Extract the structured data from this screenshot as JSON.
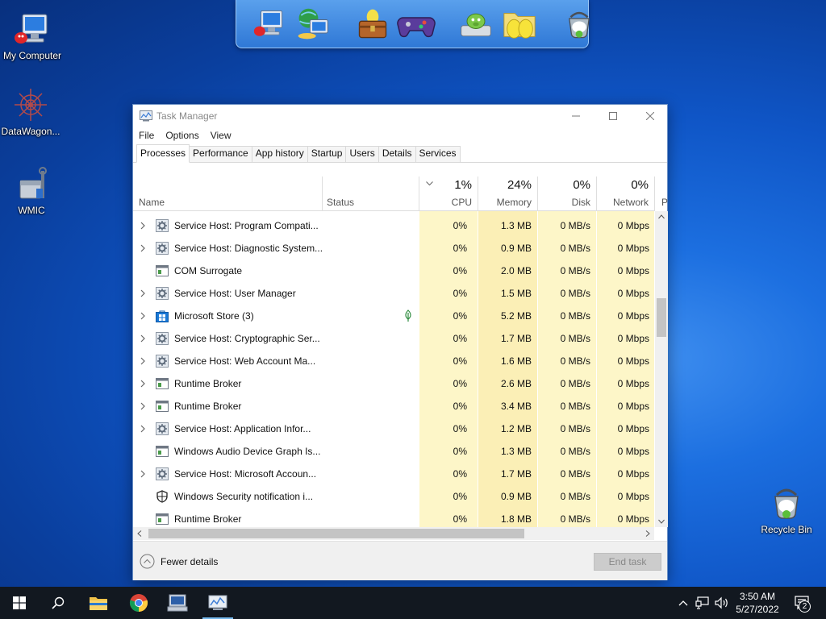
{
  "desktop": {
    "icons": [
      {
        "label": "My Computer",
        "icon": "my-computer-icon"
      },
      {
        "label": "DataWagon...",
        "icon": "datawagon-icon"
      },
      {
        "label": "WMIC",
        "icon": "wmic-icon"
      },
      {
        "label": "Recycle Bin",
        "icon": "recycle-bin-icon"
      }
    ]
  },
  "dock": {
    "items": [
      "my-computer-icon",
      "network-globe-icon",
      "treasure-chest-icon",
      "gamepad-icon",
      "green-pig-drive-icon",
      "eggs-folder-icon",
      "recycle-bin-icon"
    ]
  },
  "window": {
    "title": "Task Manager",
    "menu": [
      "File",
      "Options",
      "View"
    ],
    "tabs": [
      "Processes",
      "Performance",
      "App history",
      "Startup",
      "Users",
      "Details",
      "Services"
    ],
    "active_tab": "Processes",
    "columns": {
      "name": "Name",
      "status": "Status",
      "cpu": {
        "pct": "1%",
        "label": "CPU"
      },
      "memory": {
        "pct": "24%",
        "label": "Memory"
      },
      "disk": {
        "pct": "0%",
        "label": "Disk"
      },
      "network": {
        "pct": "0%",
        "label": "Network"
      },
      "power": {
        "label": "P"
      }
    },
    "processes": [
      {
        "name": "Service Host: Program Compati...",
        "expandable": true,
        "icon": "service-gear-icon",
        "status": "",
        "cpu": "0%",
        "memory": "1.3 MB",
        "disk": "0 MB/s",
        "network": "0 Mbps"
      },
      {
        "name": "Service Host: Diagnostic System...",
        "expandable": true,
        "icon": "service-gear-icon",
        "status": "",
        "cpu": "0%",
        "memory": "0.9 MB",
        "disk": "0 MB/s",
        "network": "0 Mbps"
      },
      {
        "name": "COM Surrogate",
        "expandable": false,
        "icon": "app-window-icon",
        "status": "",
        "cpu": "0%",
        "memory": "2.0 MB",
        "disk": "0 MB/s",
        "network": "0 Mbps"
      },
      {
        "name": "Service Host: User Manager",
        "expandable": true,
        "icon": "service-gear-icon",
        "status": "",
        "cpu": "0%",
        "memory": "1.5 MB",
        "disk": "0 MB/s",
        "network": "0 Mbps"
      },
      {
        "name": "Microsoft Store (3)",
        "expandable": true,
        "icon": "store-icon",
        "status": "suspended-leaf-icon",
        "cpu": "0%",
        "memory": "5.2 MB",
        "disk": "0 MB/s",
        "network": "0 Mbps"
      },
      {
        "name": "Service Host: Cryptographic Ser...",
        "expandable": true,
        "icon": "service-gear-icon",
        "status": "",
        "cpu": "0%",
        "memory": "1.7 MB",
        "disk": "0 MB/s",
        "network": "0 Mbps"
      },
      {
        "name": "Service Host: Web Account Ma...",
        "expandable": true,
        "icon": "service-gear-icon",
        "status": "",
        "cpu": "0%",
        "memory": "1.6 MB",
        "disk": "0 MB/s",
        "network": "0 Mbps"
      },
      {
        "name": "Runtime Broker",
        "expandable": true,
        "icon": "app-window-icon",
        "status": "",
        "cpu": "0%",
        "memory": "2.6 MB",
        "disk": "0 MB/s",
        "network": "0 Mbps"
      },
      {
        "name": "Runtime Broker",
        "expandable": true,
        "icon": "app-window-icon",
        "status": "",
        "cpu": "0%",
        "memory": "3.4 MB",
        "disk": "0 MB/s",
        "network": "0 Mbps"
      },
      {
        "name": "Service Host: Application Infor...",
        "expandable": true,
        "icon": "service-gear-icon",
        "status": "",
        "cpu": "0%",
        "memory": "1.2 MB",
        "disk": "0 MB/s",
        "network": "0 Mbps"
      },
      {
        "name": "Windows Audio Device Graph Is...",
        "expandable": false,
        "icon": "app-window-icon",
        "status": "",
        "cpu": "0%",
        "memory": "1.3 MB",
        "disk": "0 MB/s",
        "network": "0 Mbps"
      },
      {
        "name": "Service Host: Microsoft Accoun...",
        "expandable": true,
        "icon": "service-gear-icon",
        "status": "",
        "cpu": "0%",
        "memory": "1.7 MB",
        "disk": "0 MB/s",
        "network": "0 Mbps"
      },
      {
        "name": "Windows Security notification i...",
        "expandable": false,
        "icon": "shield-icon",
        "status": "",
        "cpu": "0%",
        "memory": "0.9 MB",
        "disk": "0 MB/s",
        "network": "0 Mbps"
      },
      {
        "name": "Runtime Broker",
        "expandable": false,
        "icon": "app-window-icon",
        "status": "",
        "cpu": "0%",
        "memory": "1.8 MB",
        "disk": "0 MB/s",
        "network": "0 Mbps"
      }
    ],
    "footer": {
      "fewer_details": "Fewer details",
      "end_task": "End task"
    }
  },
  "taskbar": {
    "items": [
      "start-icon",
      "search-icon",
      "file-explorer-icon",
      "chrome-icon",
      "computer-tool-icon",
      "task-manager-icon"
    ],
    "active_item": "task-manager-icon",
    "tray": [
      "chevron-up-icon",
      "network-icon",
      "volume-icon"
    ],
    "time": "3:50 AM",
    "date": "5/27/2022",
    "notification_count": "2"
  },
  "colors": {
    "desktop_blue": "#0f55c6",
    "taskbar": "#121820",
    "cpu_column": "#fdf6c8",
    "memory_column": "#fbefb6",
    "accent": "#76b9ed"
  }
}
